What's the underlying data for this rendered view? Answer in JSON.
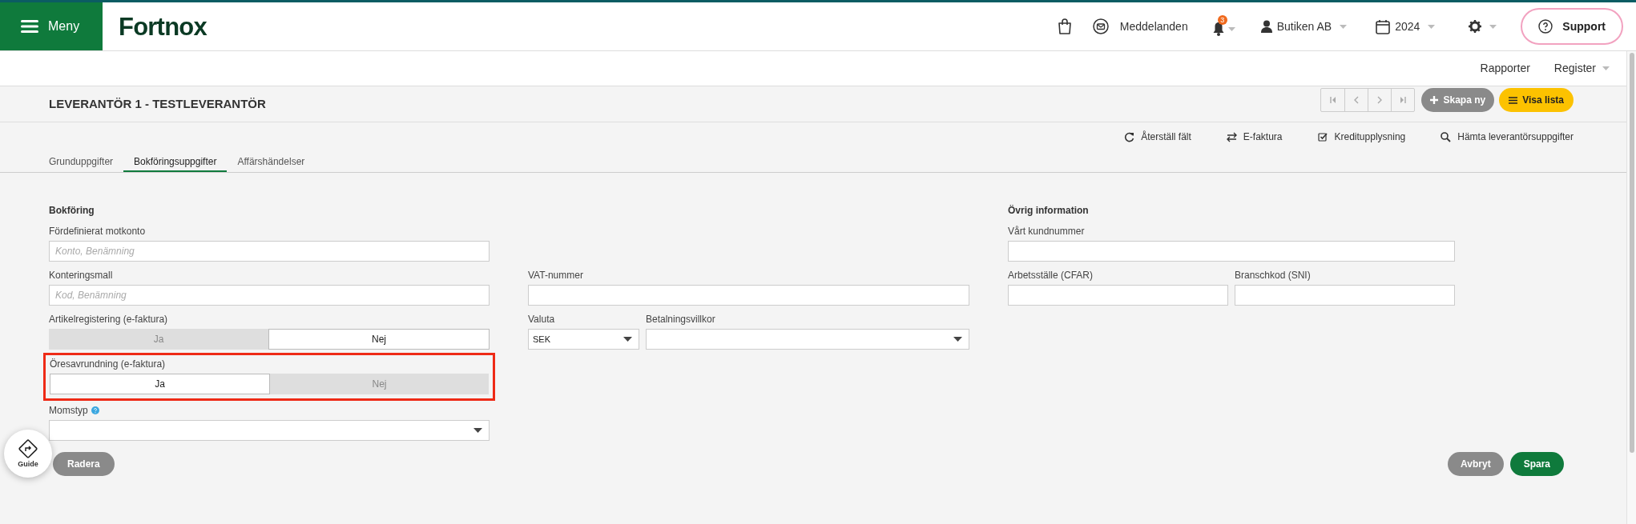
{
  "header": {
    "menu_label": "Meny",
    "logo": "Fortnox",
    "messages": "Meddelanden",
    "notification_count": "3",
    "company": "Butiken AB",
    "year": "2024",
    "support": "Support"
  },
  "subnav": [
    {
      "label": "Rapporter",
      "dropdown": false
    },
    {
      "label": "Register",
      "dropdown": true
    }
  ],
  "title": "LEVERANTÖR 1 - TESTLEVERANTÖR",
  "create_button": "Skapa ny",
  "list_button": "Visa lista",
  "actions": [
    "Återställ fält",
    "E-faktura",
    "Kreditupplysning",
    "Hämta leverantörsuppgifter"
  ],
  "tabs": [
    {
      "label": "Grunduppgifter",
      "selected": false
    },
    {
      "label": "Bokföringsuppgifter",
      "selected": true
    },
    {
      "label": "Affärshändelser",
      "selected": false
    }
  ],
  "columns": [
    {
      "heading": "Bokföring",
      "rows": [
        [
          {
            "kind": "text",
            "label": "Fördefinierat motkonto",
            "placeholder": "Konto, Benämning"
          }
        ],
        [
          {
            "kind": "text",
            "label": "Konteringsmall",
            "placeholder": "Kod, Benämning"
          }
        ],
        [
          {
            "kind": "toggle",
            "label": "Artikelregistering (e-faktura)",
            "highlighted": false,
            "options": [
              {
                "label": "Ja",
                "selected": false
              },
              {
                "label": "Nej",
                "selected": true
              }
            ]
          }
        ],
        [
          {
            "kind": "toggle",
            "label": "Öresavrundning (e-faktura)",
            "highlighted": true,
            "options": [
              {
                "label": "Ja",
                "selected": true
              },
              {
                "label": "Nej",
                "selected": false
              }
            ]
          }
        ],
        [
          {
            "kind": "select",
            "label": "Momstyp",
            "help": true
          }
        ]
      ]
    },
    {
      "rows": [
        [
          {
            "kind": "text",
            "label": "VAT-nummer"
          }
        ],
        [
          {
            "kind": "select",
            "label": "Valuta",
            "value": "SEK"
          },
          {
            "kind": "select",
            "label": "Betalningsvillkor"
          }
        ]
      ]
    },
    {
      "heading": "Övrig information",
      "rows": [
        [
          {
            "kind": "text",
            "label": "Vårt kundnummer"
          }
        ],
        [
          {
            "kind": "text",
            "label": "Arbetsställe (CFAR)"
          },
          {
            "kind": "text",
            "label": "Branschkod (SNI)"
          }
        ]
      ]
    }
  ],
  "footer": {
    "guide": "Guide",
    "delete": "Radera",
    "cancel": "Avbryt",
    "save": "Spara"
  }
}
